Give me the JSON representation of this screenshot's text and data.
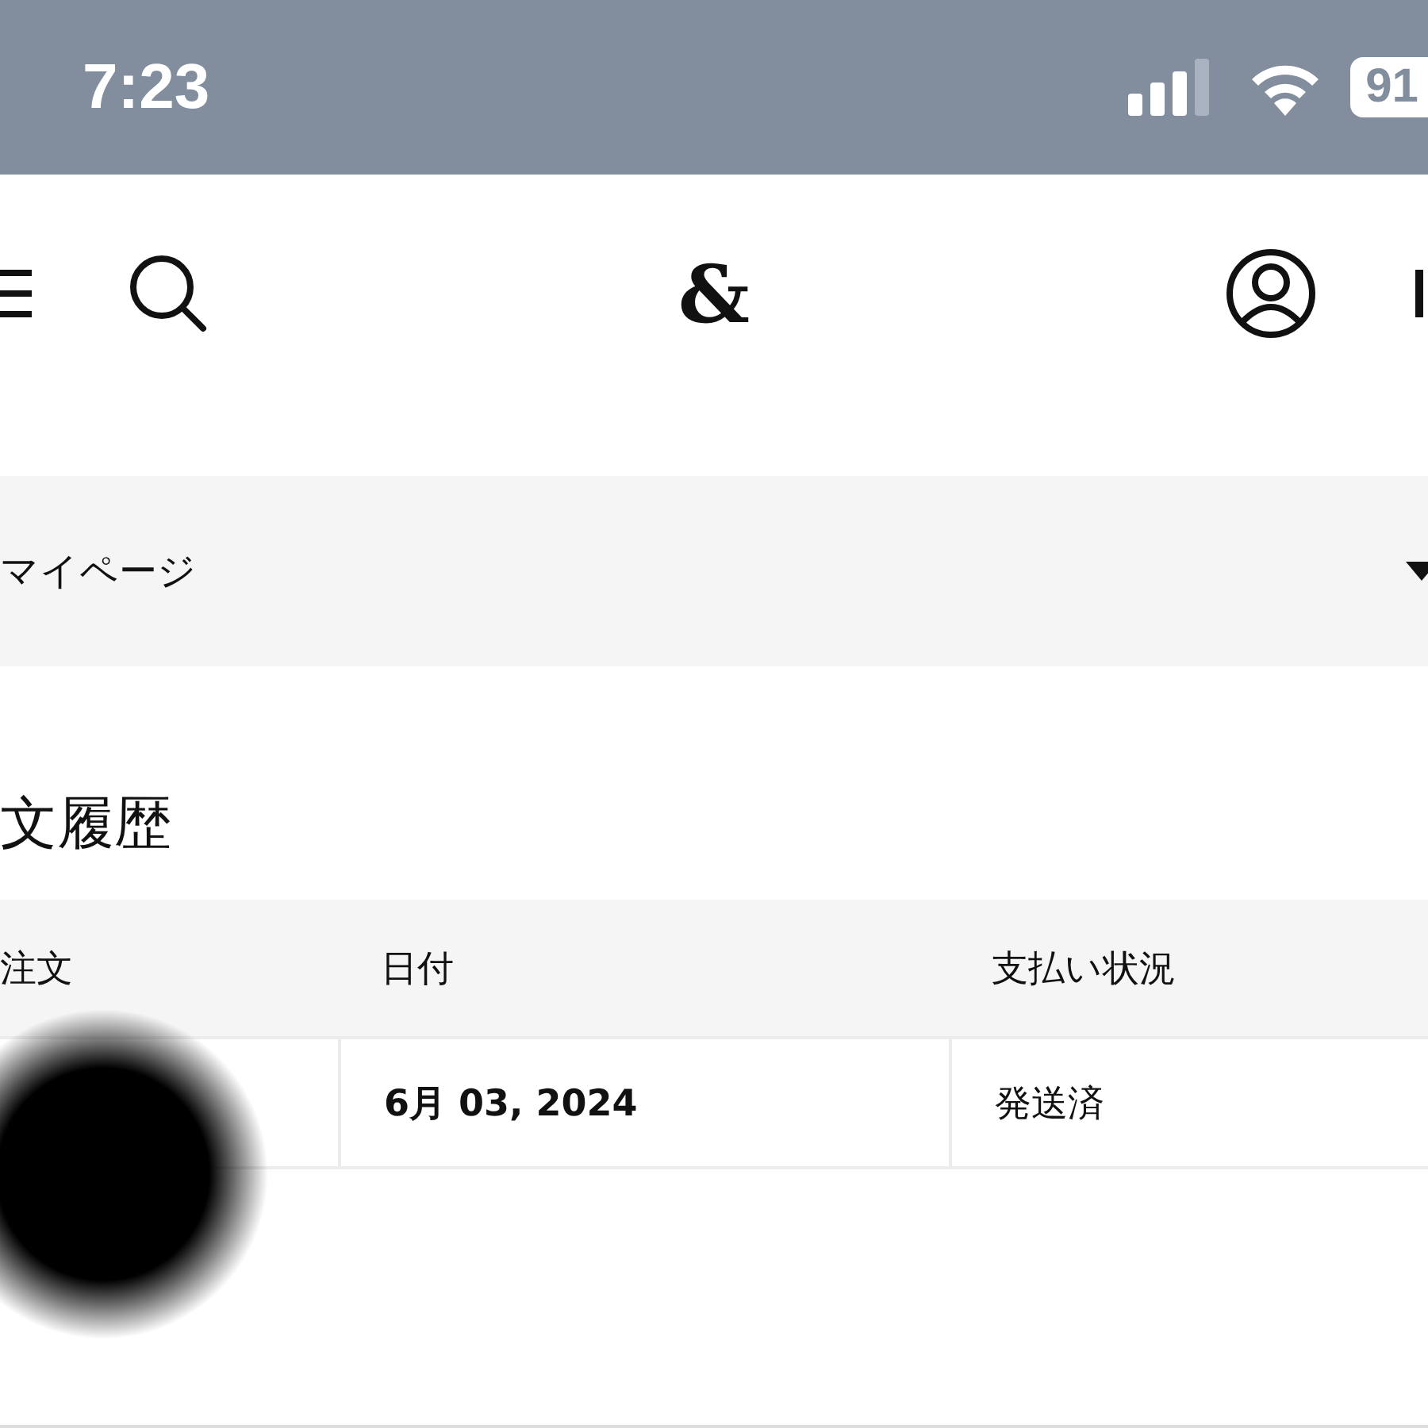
{
  "status_bar": {
    "time": "7:23",
    "battery": "91"
  },
  "header": {
    "logo": "&"
  },
  "page_menu": {
    "label": "マイページ",
    "expanded": false
  },
  "section_title": "文履歴",
  "table": {
    "columns": [
      "注文",
      "日付",
      "支払い状況"
    ],
    "rows": [
      {
        "order_redacted": true,
        "date": "6月 03, 2024",
        "status": "発送済"
      }
    ]
  }
}
